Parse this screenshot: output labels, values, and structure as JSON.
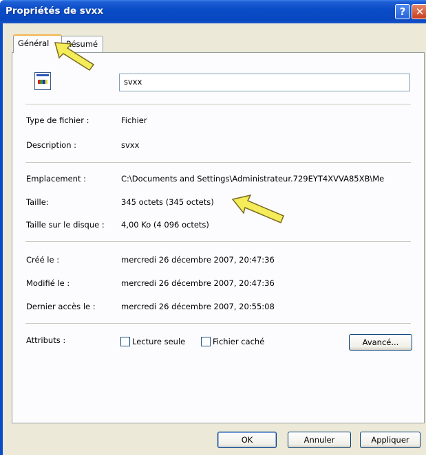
{
  "window": {
    "title": "Propriétés de svxx",
    "help_glyph": "?",
    "close_glyph": "✕"
  },
  "tabs": [
    {
      "label": "Général"
    },
    {
      "label": "Résumé"
    }
  ],
  "file_name": "svxx",
  "rows": {
    "type": {
      "label": "Type de fichier :",
      "value": "Fichier"
    },
    "description": {
      "label": "Description :",
      "value": "svxx"
    },
    "emplacement": {
      "label": "Emplacement :",
      "value": "C:\\Documents and Settings\\Administrateur.729EYT4XVVA85XB\\Me"
    },
    "taille": {
      "label": "Taille:",
      "value": "345 octets (345 octets)"
    },
    "taille_disque": {
      "label": "Taille sur le disque :",
      "value": "4,00 Ko (4 096 octets)"
    },
    "cree": {
      "label": "Créé le :",
      "value": "mercredi 26 décembre 2007, 20:47:36"
    },
    "modifie": {
      "label": "Modifié le :",
      "value": "mercredi 26 décembre 2007, 20:47:36"
    },
    "acces": {
      "label": "Dernier accès le :",
      "value": "mercredi 26 décembre 2007, 20:55:08"
    }
  },
  "attributes": {
    "label": "Attributs :",
    "read_only": "Lecture seule",
    "hidden": "Fichier caché",
    "advanced": "Avancé..."
  },
  "buttons": {
    "ok": "OK",
    "cancel": "Annuler",
    "apply": "Appliquer"
  },
  "colors": {
    "titlebar": "#0a4cc7",
    "dialog": "#ece9d8",
    "arrow": "#f5ec5a"
  }
}
